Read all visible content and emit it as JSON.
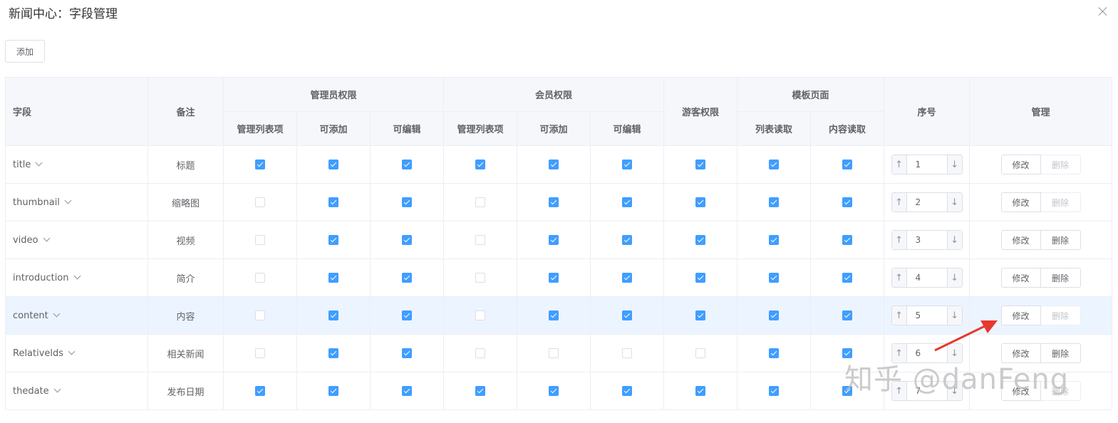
{
  "dialog": {
    "title": "新闻中心：字段管理"
  },
  "toolbar": {
    "add_label": "添加"
  },
  "table": {
    "headers": {
      "field": "字段",
      "remark": "备注",
      "admin_group": "管理员权限",
      "member_group": "会员权限",
      "guest": "游客权限",
      "template_group": "模板页面",
      "order": "序号",
      "manage": "管理",
      "list_item": "管理列表项",
      "can_add": "可添加",
      "can_edit": "可编辑",
      "list_read": "列表读取",
      "content_read": "内容读取"
    },
    "rows": [
      {
        "field": "title",
        "remark": "标题",
        "perms": [
          true,
          true,
          true,
          true,
          true,
          true,
          true,
          true,
          true
        ],
        "order": "1",
        "edit": "修改",
        "del": "删除",
        "del_disabled": true
      },
      {
        "field": "thumbnail",
        "remark": "缩略图",
        "perms": [
          false,
          true,
          true,
          false,
          true,
          true,
          true,
          true,
          true
        ],
        "order": "2",
        "edit": "修改",
        "del": "删除",
        "del_disabled": true
      },
      {
        "field": "video",
        "remark": "视频",
        "perms": [
          false,
          true,
          true,
          false,
          true,
          true,
          true,
          true,
          true
        ],
        "order": "3",
        "edit": "修改",
        "del": "删除",
        "del_disabled": false
      },
      {
        "field": "introduction",
        "remark": "简介",
        "perms": [
          false,
          true,
          true,
          false,
          true,
          true,
          true,
          true,
          true
        ],
        "order": "4",
        "edit": "修改",
        "del": "删除",
        "del_disabled": false
      },
      {
        "field": "content",
        "remark": "内容",
        "perms": [
          false,
          true,
          true,
          false,
          true,
          true,
          true,
          true,
          true
        ],
        "order": "5",
        "edit": "修改",
        "del": "删除",
        "del_disabled": true,
        "hover": true
      },
      {
        "field": "Relativelds",
        "remark": "相关新闻",
        "perms": [
          false,
          true,
          true,
          false,
          false,
          false,
          false,
          true,
          true
        ],
        "order": "6",
        "edit": "修改",
        "del": "删除",
        "del_disabled": false
      },
      {
        "field": "thedate",
        "remark": "发布日期",
        "perms": [
          true,
          true,
          true,
          true,
          true,
          true,
          true,
          true,
          true
        ],
        "order": "7",
        "edit": "修改",
        "del": "删除",
        "del_disabled": true
      }
    ]
  },
  "watermark": {
    "text": "知乎 @danFeng"
  },
  "colors": {
    "accent": "#409eff",
    "annotation": "#e8382e"
  }
}
